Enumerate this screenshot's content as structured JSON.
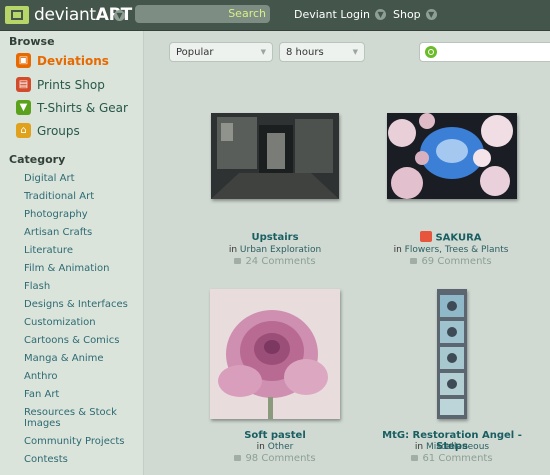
{
  "topbar": {
    "logo_text": "deviant",
    "logo_text_bold": "ART",
    "search_placeholder": "",
    "search_button": "Search",
    "login_label": "Deviant Login",
    "shop_label": "Shop"
  },
  "sidebar": {
    "browse_heading": "Browse",
    "browse_items": [
      {
        "label": "Deviations",
        "icon": "deviations-icon",
        "color": "#e66a00",
        "active": true
      },
      {
        "label": "Prints Shop",
        "icon": "prints-icon",
        "color": "#d24b2a",
        "active": false
      },
      {
        "label": "T-Shirts & Gear",
        "icon": "tshirt-icon",
        "color": "#5aa21c",
        "active": false
      },
      {
        "label": "Groups",
        "icon": "groups-icon",
        "color": "#e0a21c",
        "active": false
      }
    ],
    "category_heading": "Category",
    "categories": [
      "Digital Art",
      "Traditional Art",
      "Photography",
      "Artisan Crafts",
      "Literature",
      "Film & Animation",
      "Flash",
      "Designs & Interfaces",
      "Customization",
      "Cartoons & Comics",
      "Manga & Anime",
      "Anthro",
      "Fan Art",
      "Resources & Stock Images",
      "Community Projects",
      "Contests"
    ]
  },
  "main": {
    "sort_select": "Popular",
    "time_select": "8 hours",
    "filter_placeholder": "",
    "deviations": [
      {
        "title": "Upstairs",
        "in_label": "in",
        "category": "Urban Exploration",
        "comments": "24 Comments"
      },
      {
        "title": "SAKURA",
        "in_label": "in",
        "category": "Flowers, Trees & Plants",
        "comments": "69 Comments"
      },
      {
        "title": "Soft pastel",
        "in_label": "in",
        "category": "Other",
        "comments": "98 Comments"
      },
      {
        "title": "MtG: Restoration Angel - Steps",
        "in_label": "in",
        "category": "Miscellaneous",
        "comments": "61 Comments"
      }
    ]
  },
  "colors": {
    "topbar": "#44554b",
    "sidebar": "#dbe4db",
    "main": "#d0dad3",
    "accent": "#e66a00",
    "link": "#195e61",
    "search_accent": "#d7f085"
  }
}
